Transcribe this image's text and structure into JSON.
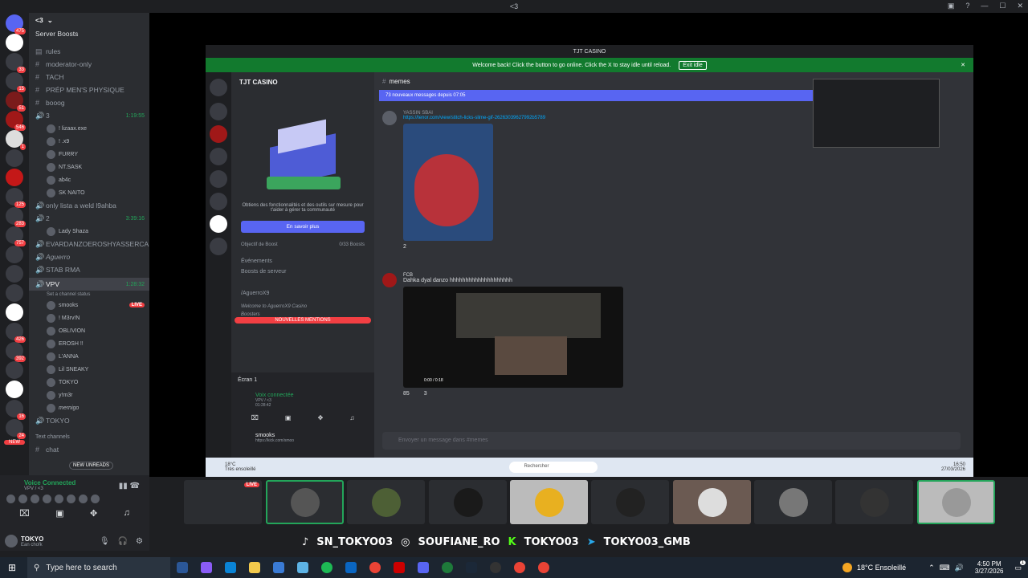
{
  "topbar": {
    "title": "<3"
  },
  "server_rail": {
    "badges": [
      "475",
      "33",
      "15",
      "51",
      "546",
      "1",
      "125",
      "283",
      "757",
      "426",
      "392",
      "16",
      "24"
    ],
    "new_label": "NEW"
  },
  "channel_list": {
    "server_name": "<3",
    "header_item": "Server Boosts",
    "channels": [
      {
        "name": "rules"
      },
      {
        "name": "moderator-only"
      },
      {
        "name": "TACH"
      },
      {
        "name": "PRÉP MEN'S PHYSIQUE"
      },
      {
        "name": "booog"
      }
    ],
    "voice_3": {
      "name": "3",
      "time": "1:19:55",
      "users": [
        "! lizaax.exe",
        "! .x9",
        "FURRY",
        "NT.SASK",
        "ab4c",
        "SK NAITO"
      ]
    },
    "only_lista": "only lista a weld l9ahba",
    "voice_2": {
      "name": "2",
      "time": "3:39:16",
      "users": [
        "Lady Shaza"
      ]
    },
    "more_channels": [
      "EVARDANZOEROSHYASSERCA...",
      "Aguerro",
      "STAB RMA"
    ],
    "vpv": {
      "name": "VPV",
      "status": "Set a channel status",
      "time": "1:28:32",
      "users": [
        "smooks",
        "! M3rv!N",
        "OBLIVION",
        "EROSH !!",
        "L'ANNA",
        "Lil SNEAKY",
        "TOKYO",
        "y!m3r",
        "mernigo"
      ],
      "live": "LIVE"
    },
    "tokyo_channel": "TOKYO",
    "text_channels": "Text channels",
    "chat": "chat",
    "new_unreads": "NEW UNREADS"
  },
  "voice_panel": {
    "status": "Voice Connected",
    "channel": "VPV / <3",
    "user": "TOKYO",
    "user_status": "Ean chofk"
  },
  "stream": {
    "window_title": "TJT CASINO",
    "banner": "Welcome back! Click the button to go online. Click the X to stay idle until reload.",
    "banner_button": "Exit idle",
    "inner_server": "TJT CASINO",
    "channel": "memes",
    "new_messages": "73 nouveaux messages depuis 07:05",
    "promo_text": "Obtiens des fonctionnalités et des outils sur mesure pour t'aider à gérer ta communauté",
    "promo_button": "En savoir plus",
    "boost_goal": "Objectif de Boost",
    "boost_count": "0/33 Boosts",
    "events": "Événements",
    "boosts": "Boosts de serveur",
    "channel_aguerro": "/AguerroX9",
    "welcome": "Welcome to AguerroX9 Casino",
    "boosters": "Boosters",
    "mentions": "NOUVELLES MENTIONS",
    "screen": "Écran 1",
    "voice_connected": "Voix connectée",
    "voice_channel": "VPV / <3",
    "voice_time": "01:28:42",
    "username": "smooks",
    "username_sub": "https://kick.com/smoo",
    "msg1_author": "YASSIN SBAI",
    "msg1_link": "https://tenor.com/view/stitch-licks-slime-gif-26263039627992b5789",
    "msg1_reactions": [
      "2"
    ],
    "msg2_author": "FCB",
    "msg2_text": "Dahka dyal danzo hhhhhhhhhhhhhhhhhhhh",
    "msg2_video_time": "0:00 / 0:18",
    "msg2_reactions": [
      "85",
      "3"
    ],
    "input_placeholder": "Envoyer un message dans #memes",
    "weather": "18°C",
    "weather_sub": "Très ensoleillé",
    "search": "Rechercher",
    "clock_time": "16:50",
    "clock_date": "27/03/2026"
  },
  "social": {
    "items": [
      "SN_TOKYO03",
      "SOUFIANE_RO",
      "TOKYO03",
      "TOKYO03_GMB"
    ]
  },
  "taskbar": {
    "search": "Type here to search",
    "weather": "18°C Ensoleillé",
    "time": "4:50 PM",
    "date": "3/27/2026",
    "notif": "1"
  },
  "colors": {
    "green": "#23a55a",
    "red": "#f23f43",
    "blurple": "#5865f2",
    "banner": "#127a2e"
  }
}
